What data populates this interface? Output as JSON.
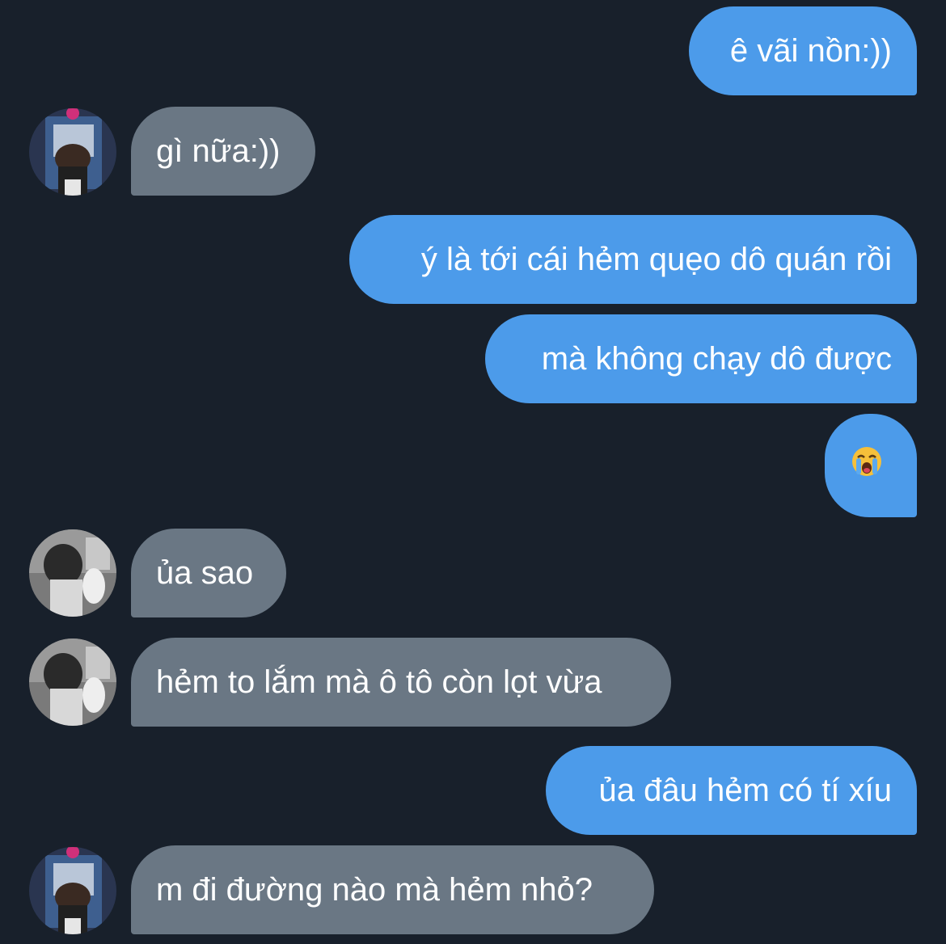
{
  "conversation": {
    "messages": [
      {
        "from": "me",
        "text": "ê vãi nồn:))"
      },
      {
        "from": "other",
        "avatar": "avatar-blue-photo",
        "text": "gì nữa:))"
      },
      {
        "from": "me",
        "text": "ý là tới cái hẻm quẹo dô quán rồi"
      },
      {
        "from": "me",
        "text": "mà không chạy dô được"
      },
      {
        "from": "me",
        "emoji": "loudly-crying-face-emoji"
      },
      {
        "from": "other",
        "avatar": "avatar-grayscale-photo",
        "text": "ủa sao"
      },
      {
        "from": "other",
        "avatar": "avatar-grayscale-photo",
        "text": "hẻm to lắm mà ô tô còn lọt vừa"
      },
      {
        "from": "me",
        "text": "ủa đâu hẻm có tí xíu"
      },
      {
        "from": "other",
        "avatar": "avatar-blue-photo",
        "text": "m đi đường nào mà hẻm nhỏ?"
      }
    ]
  },
  "colors": {
    "background": "#18202b",
    "sent_bubble": "#4c9bea",
    "received_bubble": "#6a7784",
    "text": "#ffffff"
  }
}
